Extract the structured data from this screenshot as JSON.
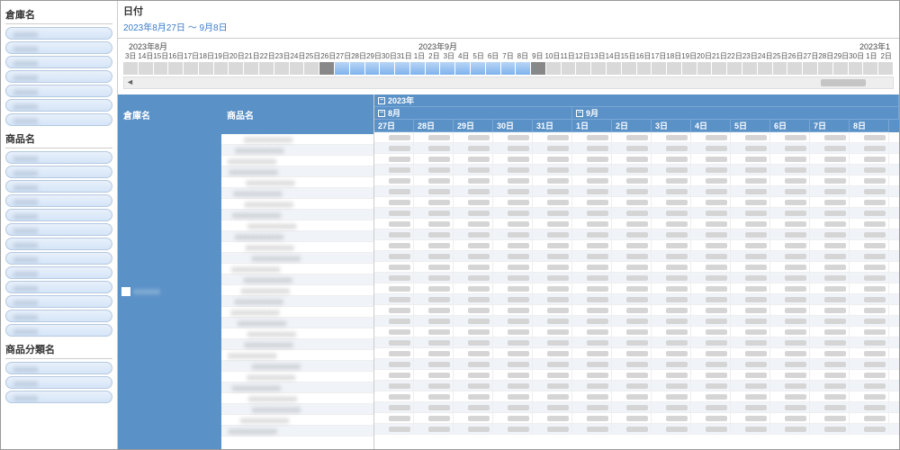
{
  "left": {
    "section1_title": "倉庫名",
    "section1_items": [
      "xxxxxx",
      "xxxxxx",
      "xxxxxx",
      "xxxxxx",
      "xxxxxx",
      "xxxxxx",
      "xxxxxx"
    ],
    "section2_title": "商品名",
    "section2_items": [
      "xxxxxx",
      "xxxxxx",
      "xxxxxx",
      "xxxxxx",
      "xxxxxx",
      "xxxxxx",
      "xxxxxx",
      "xxxxxx",
      "xxxxxx",
      "xxxxxx",
      "xxxxxx",
      "xxxxxx",
      "xxxxxx"
    ],
    "section3_title": "商品分類名",
    "section3_items": [
      "xxxxxx",
      "xxxxxx",
      "xxxxxx"
    ]
  },
  "header": {
    "title": "日付",
    "range": "2023年8月27日 ～ 9月8日"
  },
  "timeline": {
    "month1": "2023年8月",
    "month2": "2023年9月",
    "month3": "2023年1",
    "days": [
      "3日",
      "14日",
      "15日",
      "16日",
      "17日",
      "18日",
      "19日",
      "20日",
      "21日",
      "22日",
      "23日",
      "24日",
      "25日",
      "26日",
      "27日",
      "28日",
      "29日",
      "30日",
      "31日",
      "1日",
      "2日",
      "3日",
      "4日",
      "5日",
      "6日",
      "7日",
      "8日",
      "9日",
      "10日",
      "11日",
      "12日",
      "13日",
      "14日",
      "15日",
      "16日",
      "17日",
      "18日",
      "19日",
      "20日",
      "21日",
      "22日",
      "23日",
      "24日",
      "25日",
      "26日",
      "27日",
      "28日",
      "29日",
      "30日",
      "1日",
      "2日"
    ],
    "sel_start": 14,
    "sel_end": 27
  },
  "grid": {
    "col1_header": "倉庫名",
    "col2_header": "商品名",
    "year": "2023年",
    "month_aug": "8月",
    "month_sep": "9月",
    "days_aug": [
      "27日",
      "28日",
      "29日",
      "30日",
      "31日"
    ],
    "days_sep": [
      "1日",
      "2日",
      "3日",
      "4日",
      "5日",
      "6日",
      "7日",
      "8日"
    ],
    "col1_value": "xxxxxx",
    "row_count": 28
  }
}
